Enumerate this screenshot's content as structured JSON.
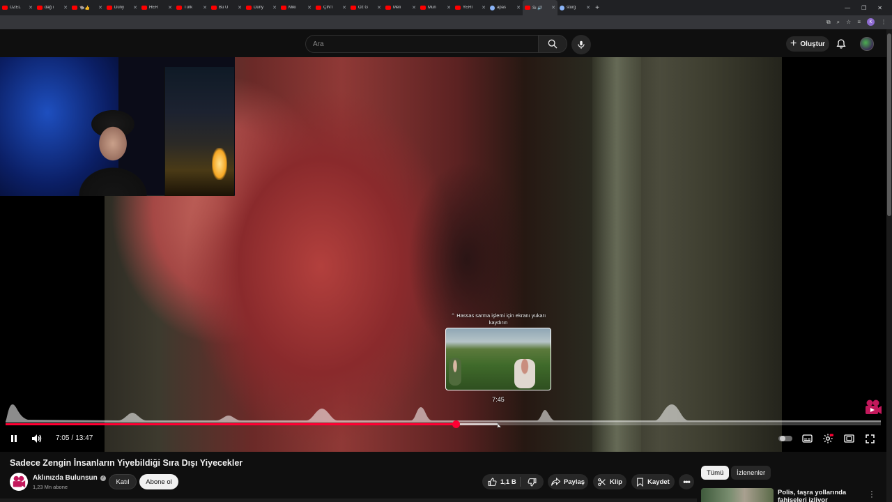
{
  "browser": {
    "tabs": [
      {
        "label": "ÖZEL",
        "icon": "youtube-icon"
      },
      {
        "label": "dağ ı",
        "icon": "youtube-icon"
      },
      {
        "label": "🐃👍",
        "icon": "youtube-icon"
      },
      {
        "label": "Düny",
        "icon": "youtube-icon"
      },
      {
        "label": "HER",
        "icon": "youtube-icon"
      },
      {
        "label": "Türk",
        "icon": "youtube-icon"
      },
      {
        "label": "Bu Ü",
        "icon": "youtube-icon"
      },
      {
        "label": "Düny",
        "icon": "youtube-icon"
      },
      {
        "label": "Mikı",
        "icon": "youtube-icon"
      },
      {
        "label": "ÇİN'İ",
        "icon": "youtube-icon"
      },
      {
        "label": "Öz G",
        "icon": "youtube-icon"
      },
      {
        "label": "Meli",
        "icon": "youtube-icon"
      },
      {
        "label": "Mun",
        "icon": "youtube-icon"
      },
      {
        "label": "YERİ",
        "icon": "youtube-icon"
      },
      {
        "label": "apas",
        "icon": "globe-icon"
      },
      {
        "label": "Sı 🔊",
        "icon": "youtube-icon",
        "active": true
      },
      {
        "label": "sturg",
        "icon": "globe-icon"
      }
    ],
    "new_tab": "+",
    "window_controls": [
      "—",
      "❐",
      "✕"
    ],
    "profile_initial": "K"
  },
  "masthead": {
    "search_placeholder": "Ara",
    "create_label": "Oluştur"
  },
  "player": {
    "hint": "Hassas sarma işlemi için ekranı yukarı kaydırın",
    "preview_time": "7:45",
    "current_time": "7:05",
    "duration": "13:47",
    "time_separator": "/",
    "played_fraction": 0.514,
    "hover_fraction": 0.563
  },
  "video": {
    "title": "Sadece Zengin İnsanların Yiyebildiği Sıra Dışı Yiyecekler",
    "channel": "Aklınızda Bulunsun",
    "subscribers": "1,23 Mn abone",
    "join_label": "Katıl",
    "subscribe_label": "Abone ol",
    "likes": "1,1 B",
    "share_label": "Paylaş",
    "clip_label": "Klip",
    "save_label": "Kaydet",
    "more_label": "•••"
  },
  "sidebar": {
    "chips": [
      "Tümü",
      "İzlenenler"
    ],
    "recommendation_title": "Polis, taşra yollarında fahişeleri izliyor"
  },
  "colors": {
    "accent": "#ff0033",
    "background": "#0f0f0f",
    "surface": "#272727"
  }
}
